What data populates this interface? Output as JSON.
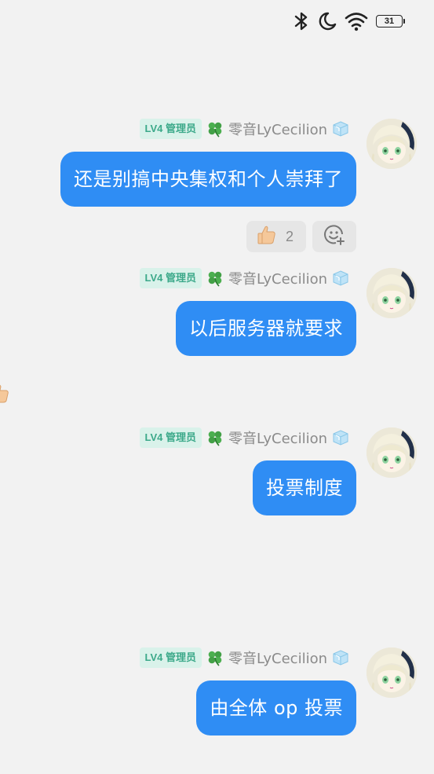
{
  "status_bar": {
    "icons": [
      "bluetooth-icon",
      "moon-icon",
      "wifi-icon"
    ],
    "battery": "31"
  },
  "colors": {
    "bubble": "#2f8df4",
    "badge_bg": "#d9f2ea",
    "badge_text": "#3ca98a",
    "nickname": "#8b8b8b",
    "background": "#f2f2f2"
  },
  "messages": [
    {
      "badge": "LV4 管理员",
      "nickname": "零音LyCecilion",
      "text": "还是别搞中央集权和个人崇拜了"
    },
    {
      "badge": "LV4 管理员",
      "nickname": "零音LyCecilion",
      "text": "以后服务器就要求"
    },
    {
      "badge": "LV4 管理员",
      "nickname": "零音LyCecilion",
      "text": "投票制度"
    },
    {
      "badge": "LV4 管理员",
      "nickname": "零音LyCecilion",
      "text": "由全体 op 投票"
    }
  ],
  "reactions": {
    "thumbs_up_count": "2",
    "add_reaction_icon": "add-emoji-icon"
  }
}
